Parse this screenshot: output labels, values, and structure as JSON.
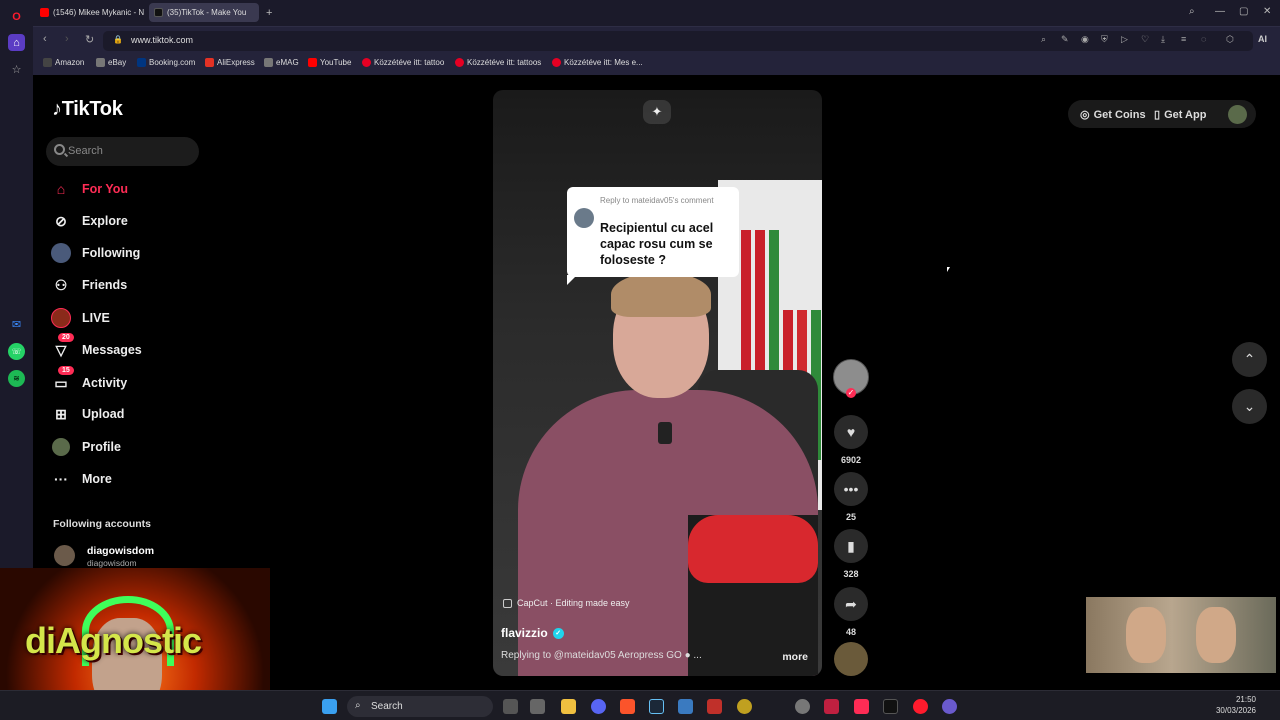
{
  "browser": {
    "tabs": [
      {
        "label": "(1546) Mikee Mykanic - N"
      },
      {
        "label": "(35)TikTok - Make You"
      }
    ],
    "new_tab": "+",
    "url": "www.tiktok.com",
    "ai_label": "AI",
    "bookmarks": [
      {
        "label": "Amazon"
      },
      {
        "label": "eBay"
      },
      {
        "label": "Booking.com"
      },
      {
        "label": "AliExpress"
      },
      {
        "label": "eMAG"
      },
      {
        "label": "YouTube"
      },
      {
        "label": "Közzétéve itt: tattoo"
      },
      {
        "label": "Közzétéve itt: tattoos"
      },
      {
        "label": "Közzétéve itt: Mes e..."
      }
    ]
  },
  "tiktok": {
    "logo": "TikTok",
    "search_placeholder": "Search",
    "nav": [
      {
        "label": "For You",
        "icon": "home-icon",
        "active": true
      },
      {
        "label": "Explore",
        "icon": "compass-icon"
      },
      {
        "label": "Following",
        "icon": "following-avatar-icon"
      },
      {
        "label": "Friends",
        "icon": "friends-icon"
      },
      {
        "label": "LIVE",
        "icon": "live-icon"
      },
      {
        "label": "Messages",
        "icon": "messages-icon",
        "badge": "20"
      },
      {
        "label": "Activity",
        "icon": "activity-icon",
        "badge": "15"
      },
      {
        "label": "Upload",
        "icon": "upload-icon"
      },
      {
        "label": "Profile",
        "icon": "profile-avatar-icon"
      },
      {
        "label": "More",
        "icon": "more-icon"
      }
    ],
    "following_header": "Following accounts",
    "following": [
      {
        "name": "diagowisdom",
        "handle": "diagowisdom"
      }
    ],
    "get_coins": "Get Coins",
    "get_app": "Get App",
    "video": {
      "reply_to": "Reply to mateidav05's comment",
      "question": "Recipientul cu acel capac rosu cum se foloseste ?",
      "capcut": "CapCut · Editing made easy",
      "author": "flavizzio",
      "description": "Replying to @mateidav05 Aeropress GO ● ...",
      "more": "more"
    },
    "actions": {
      "likes": "6902",
      "comments": "25",
      "saves": "328",
      "shares": "48"
    }
  },
  "overlay": {
    "webcam_text": "diAgnostic"
  },
  "taskbar": {
    "search": "Search",
    "time": "21:50",
    "date": "30/03/2026"
  },
  "colors": {
    "accent": "#fe2c55",
    "browser_bg": "#1b1a2a",
    "verified": "#20d5ec"
  }
}
